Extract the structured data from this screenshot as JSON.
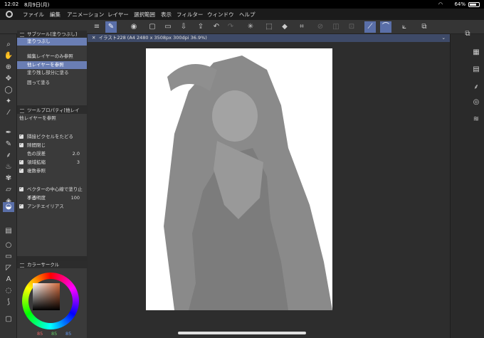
{
  "status": {
    "time": "12:02",
    "date": "8月9日(月)",
    "battery": "64%",
    "battery_level": 0.64
  },
  "menu": [
    "ファイル",
    "編集",
    "アニメーション",
    "レイヤー",
    "選択範囲",
    "表示",
    "フィルター",
    "ウィンドウ",
    "ヘルプ"
  ],
  "subtool": {
    "title": "サブツール[塗りつぶし]",
    "items": [
      "塗りつぶし",
      "編集レイヤーのみ参照",
      "他レイヤーを参照",
      "塗り残し部分に塗る",
      "囲って塗る"
    ]
  },
  "toolprop": {
    "title": "ツールプロパティ[他レイ",
    "name": "他レイヤーを参照",
    "opts": [
      "隣接ピクセルをたどる",
      "隙間閉じ",
      "色の誤差",
      "領域拡縮",
      "複数参照",
      "ベクターの中心線で塗り止まる",
      "不透明度",
      "アンチエイリアス"
    ],
    "color_tol": "2.0",
    "expand": "3",
    "opacity": "100"
  },
  "canvas": {
    "tab": "イラスト228 (A4 2480 x 3508px 300dpi 36.9%)"
  },
  "color": {
    "title": "カラーサークル",
    "h": "85",
    "s": "85",
    "v": "85"
  }
}
